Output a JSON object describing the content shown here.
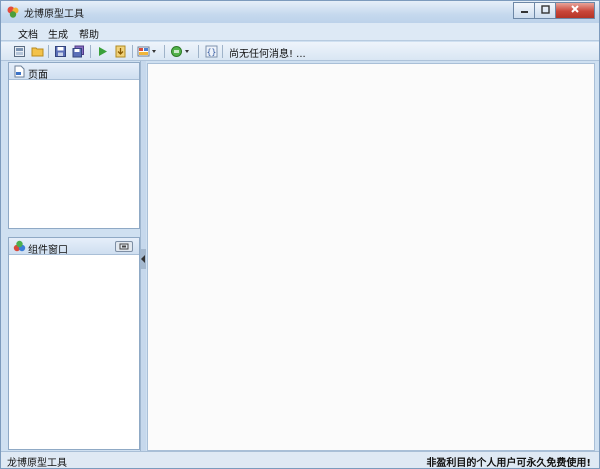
{
  "window": {
    "title": "龙博原型工具",
    "icon": "app-logo-icon",
    "controls": [
      "minimize-icon",
      "maximize-icon",
      "close-icon"
    ]
  },
  "menu": {
    "items": [
      "文档",
      "生成",
      "帮助"
    ]
  },
  "toolbar": {
    "buttons": [
      "home-icon",
      "open-folder-icon",
      "save-icon",
      "save-all-icon",
      "run-icon",
      "export-icon",
      "layout-dropdown-icon",
      "component-dropdown-icon",
      "code-icon"
    ],
    "status_message": "尚无任何消息! ..."
  },
  "panels": {
    "pages": {
      "title": "页面",
      "icon": "page-icon"
    },
    "components": {
      "title": "组件窗口",
      "icon": "components-icon"
    }
  },
  "statusbar": {
    "left": "龙博原型工具",
    "right": "非盈利目的个人用户可永久免费使用!"
  },
  "colors": {
    "accent": "#c9463a",
    "chrome": "#cfe0f1"
  }
}
